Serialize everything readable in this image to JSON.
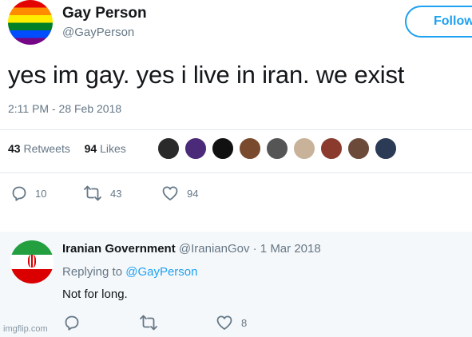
{
  "tweet": {
    "author_name": "Gay Person",
    "author_handle": "@GayPerson",
    "follow_label": "Follow",
    "text": "yes im gay. yes i live in iran. we exist",
    "timestamp": "2:11 PM - 28 Feb 2018",
    "retweets_count": "43",
    "retweets_label": "Retweets",
    "likes_count": "94",
    "likes_label": "Likes",
    "actions": {
      "reply_count": "10",
      "retweet_count": "43",
      "like_count": "94"
    }
  },
  "reply": {
    "author_name": "Iranian Government",
    "author_meta": "@IranianGov · 1 Mar 2018",
    "replying_label": "Replying to",
    "replying_mention": "@GayPerson",
    "text": "Not for long.",
    "actions": {
      "like_count": "8"
    }
  },
  "watermark": "imgflip.com",
  "colors": {
    "accent": "#1da1f2",
    "secondary_text": "#657786",
    "primary_text": "#14171a"
  },
  "icons": {
    "reply": "reply-icon",
    "retweet": "retweet-icon",
    "like": "heart-icon"
  }
}
